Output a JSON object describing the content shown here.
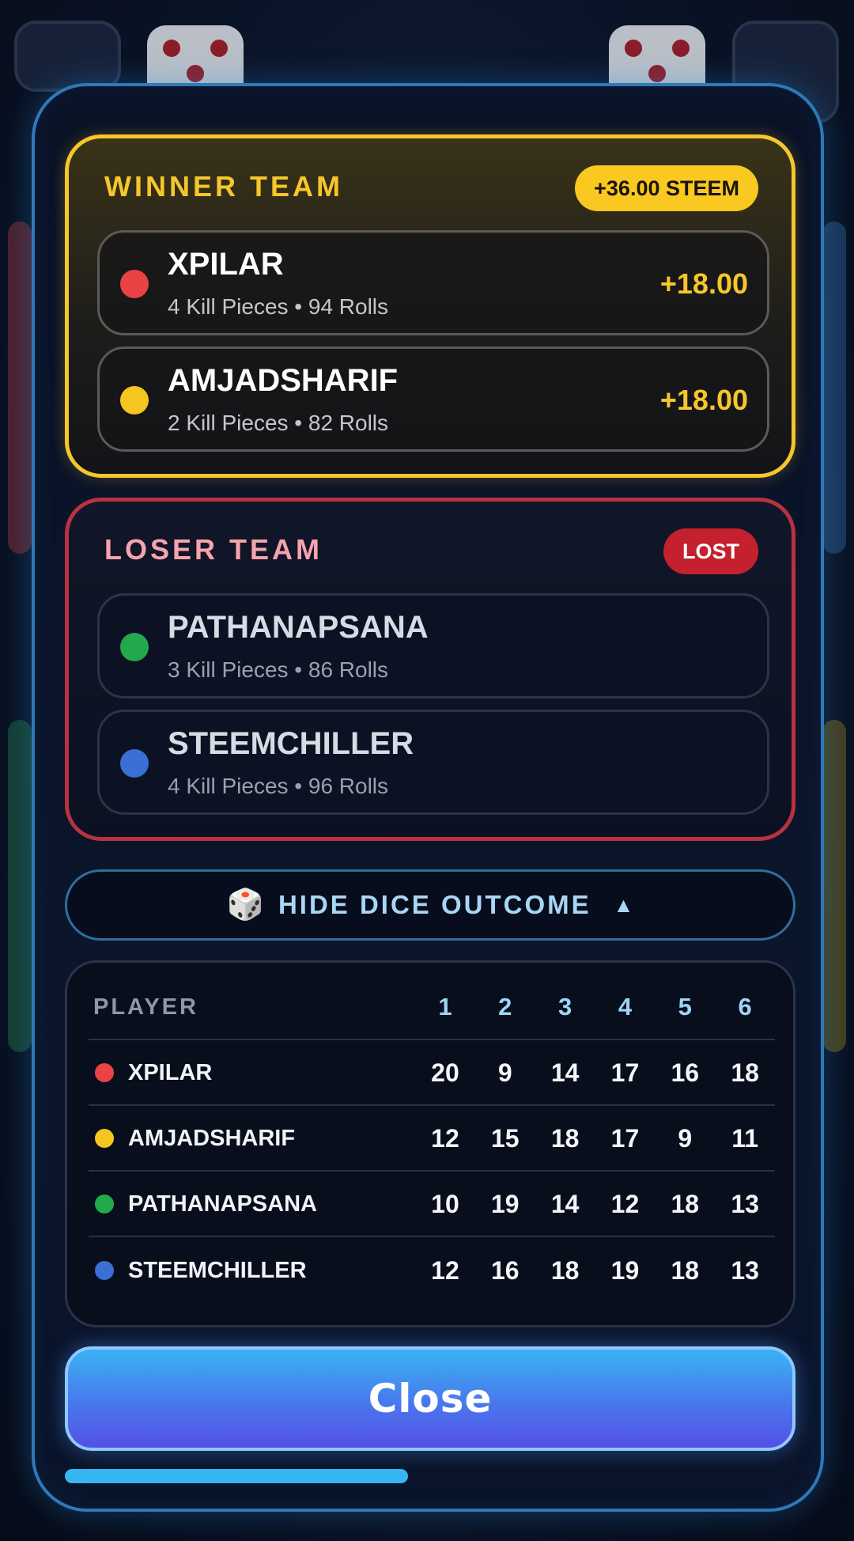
{
  "winner_team": {
    "title": "WINNER TEAM",
    "badge": "+36.00 STEEM",
    "players": [
      {
        "name": "XPILAR",
        "stats": "4 Kill Pieces • 94 Rolls",
        "amount": "+18.00",
        "color": "#e94345"
      },
      {
        "name": "AMJADSHARIF",
        "stats": "2 Kill Pieces • 82 Rolls",
        "amount": "+18.00",
        "color": "#f6c51f"
      }
    ]
  },
  "loser_team": {
    "title": "LOSER TEAM",
    "badge": "LOST",
    "players": [
      {
        "name": "PATHANAPSANA",
        "stats": "3 Kill Pieces • 86 Rolls",
        "color": "#22a94c"
      },
      {
        "name": "STEEMCHILLER",
        "stats": "4 Kill Pieces • 96 Rolls",
        "color": "#3b6fd3"
      }
    ]
  },
  "dice_toggle": {
    "icon": "🎲",
    "label": "HIDE DICE OUTCOME",
    "caret": "▲"
  },
  "dice_outcome": {
    "headers": [
      "PLAYER",
      "1",
      "2",
      "3",
      "4",
      "5",
      "6"
    ],
    "rows": [
      {
        "name": "XPILAR",
        "color": "#e94345",
        "values": [
          "20",
          "9",
          "14",
          "17",
          "16",
          "18"
        ]
      },
      {
        "name": "AMJADSHARIF",
        "color": "#f6c51f",
        "values": [
          "12",
          "15",
          "18",
          "17",
          "9",
          "11"
        ]
      },
      {
        "name": "PATHANAPSANA",
        "color": "#22a94c",
        "values": [
          "10",
          "19",
          "14",
          "12",
          "18",
          "13"
        ]
      },
      {
        "name": "STEEMCHILLER",
        "color": "#3b6fd3",
        "values": [
          "12",
          "16",
          "18",
          "19",
          "18",
          "13"
        ]
      }
    ]
  },
  "close_button": {
    "label": "Close"
  },
  "timer_progress": {
    "fraction": 0.47
  },
  "colors": {
    "accent_gold": "#f6c62b",
    "accent_red": "#c5202d",
    "accent_blue": "#35b6f2"
  }
}
